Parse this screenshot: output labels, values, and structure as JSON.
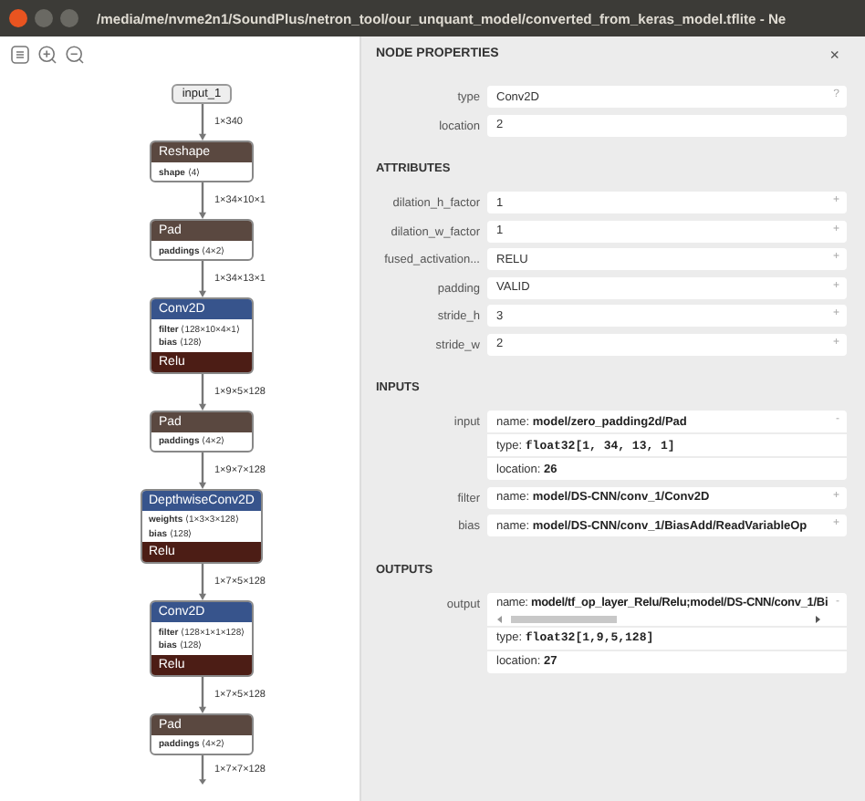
{
  "window": {
    "title": "/media/me/nvme2n1/SoundPlus/netron_tool/our_unquant_model/converted_from_keras_model.tflite - Ne"
  },
  "graph": {
    "items": [
      {
        "kind": "input",
        "title": "input_1"
      },
      {
        "kind": "edge",
        "label": "1×340"
      },
      {
        "kind": "layer",
        "title": "Reshape",
        "attributes": [
          {
            "name": "shape",
            "value": "⟨4⟩"
          }
        ]
      },
      {
        "kind": "edge",
        "label": "1×34×10×1"
      },
      {
        "kind": "layer",
        "title": "Pad",
        "attributes": [
          {
            "name": "paddings",
            "value": "⟨4×2⟩"
          }
        ]
      },
      {
        "kind": "edge",
        "label": "1×34×13×1"
      },
      {
        "kind": "conv",
        "title": "Conv2D",
        "attributes": [
          {
            "name": "filter",
            "value": "⟨128×10×4×1⟩"
          },
          {
            "name": "bias",
            "value": "⟨128⟩"
          }
        ],
        "activation": "Relu"
      },
      {
        "kind": "edge",
        "label": "1×9×5×128"
      },
      {
        "kind": "layer",
        "title": "Pad",
        "attributes": [
          {
            "name": "paddings",
            "value": "⟨4×2⟩"
          }
        ]
      },
      {
        "kind": "edge",
        "label": "1×9×7×128"
      },
      {
        "kind": "conv",
        "title": "DepthwiseConv2D",
        "attributes": [
          {
            "name": "weights",
            "value": "⟨1×3×3×128⟩"
          },
          {
            "name": "bias",
            "value": "⟨128⟩"
          }
        ],
        "activation": "Relu"
      },
      {
        "kind": "edge",
        "label": "1×7×5×128"
      },
      {
        "kind": "conv",
        "title": "Conv2D",
        "attributes": [
          {
            "name": "filter",
            "value": "⟨128×1×1×128⟩"
          },
          {
            "name": "bias",
            "value": "⟨128⟩"
          }
        ],
        "activation": "Relu"
      },
      {
        "kind": "edge",
        "label": "1×7×5×128"
      },
      {
        "kind": "layer",
        "title": "Pad",
        "attributes": [
          {
            "name": "paddings",
            "value": "⟨4×2⟩"
          }
        ]
      },
      {
        "kind": "edge",
        "label": "1×7×7×128"
      }
    ]
  },
  "properties": {
    "title": "NODE PROPERTIES",
    "close": "×",
    "rows": [
      {
        "label": "type",
        "lines": [
          {
            "kind": "plain",
            "text": "Conv2D"
          }
        ],
        "button": "?"
      },
      {
        "label": "location",
        "lines": [
          {
            "kind": "plain",
            "text": "2"
          }
        ]
      }
    ],
    "sections": [
      {
        "title": "ATTRIBUTES",
        "rows": [
          {
            "label": "dilation_h_factor",
            "lines": [
              {
                "kind": "plain",
                "text": "1"
              }
            ],
            "button": "+"
          },
          {
            "label": "dilation_w_factor",
            "lines": [
              {
                "kind": "plain",
                "text": "1"
              }
            ],
            "button": "+"
          },
          {
            "label": "fused_activation...",
            "lines": [
              {
                "kind": "plain",
                "text": "RELU"
              }
            ],
            "button": "+"
          },
          {
            "label": "padding",
            "lines": [
              {
                "kind": "plain",
                "text": "VALID"
              }
            ],
            "button": "+"
          },
          {
            "label": "stride_h",
            "lines": [
              {
                "kind": "plain",
                "text": "3"
              }
            ],
            "button": "+"
          },
          {
            "label": "stride_w",
            "lines": [
              {
                "kind": "plain",
                "text": "2"
              }
            ],
            "button": "+"
          }
        ]
      },
      {
        "title": "INPUTS",
        "rows": [
          {
            "label": "input",
            "lines": [
              {
                "kind": "name",
                "text": "name: **model/zero_padding2d/Pad**"
              },
              {
                "kind": "type",
                "text": "type: **float32[1, 34, 13, 1]**"
              },
              {
                "kind": "location",
                "text": "location: **26**"
              }
            ],
            "button": "-"
          },
          {
            "label": "filter",
            "lines": [
              {
                "kind": "name",
                "text": "name: **model/DS-CNN/conv_1/Conv2D**"
              }
            ],
            "button": "+"
          },
          {
            "label": "bias",
            "lines": [
              {
                "kind": "name",
                "text": "name: **model/DS-CNN/conv_1/BiasAdd/ReadVariableOp**"
              }
            ],
            "button": "+"
          }
        ]
      },
      {
        "title": "OUTPUTS",
        "rows": [
          {
            "label": "output",
            "lines": [
              {
                "kind": "scrollname",
                "text": "name: **model/tf_op_layer_Relu/Relu;model/DS-CNN/conv_1/Bi**"
              },
              {
                "kind": "type",
                "text": "type: **float32[1,9,5,128]**"
              },
              {
                "kind": "location",
                "text": "location: **27**"
              }
            ],
            "button": "-"
          }
        ]
      }
    ]
  }
}
